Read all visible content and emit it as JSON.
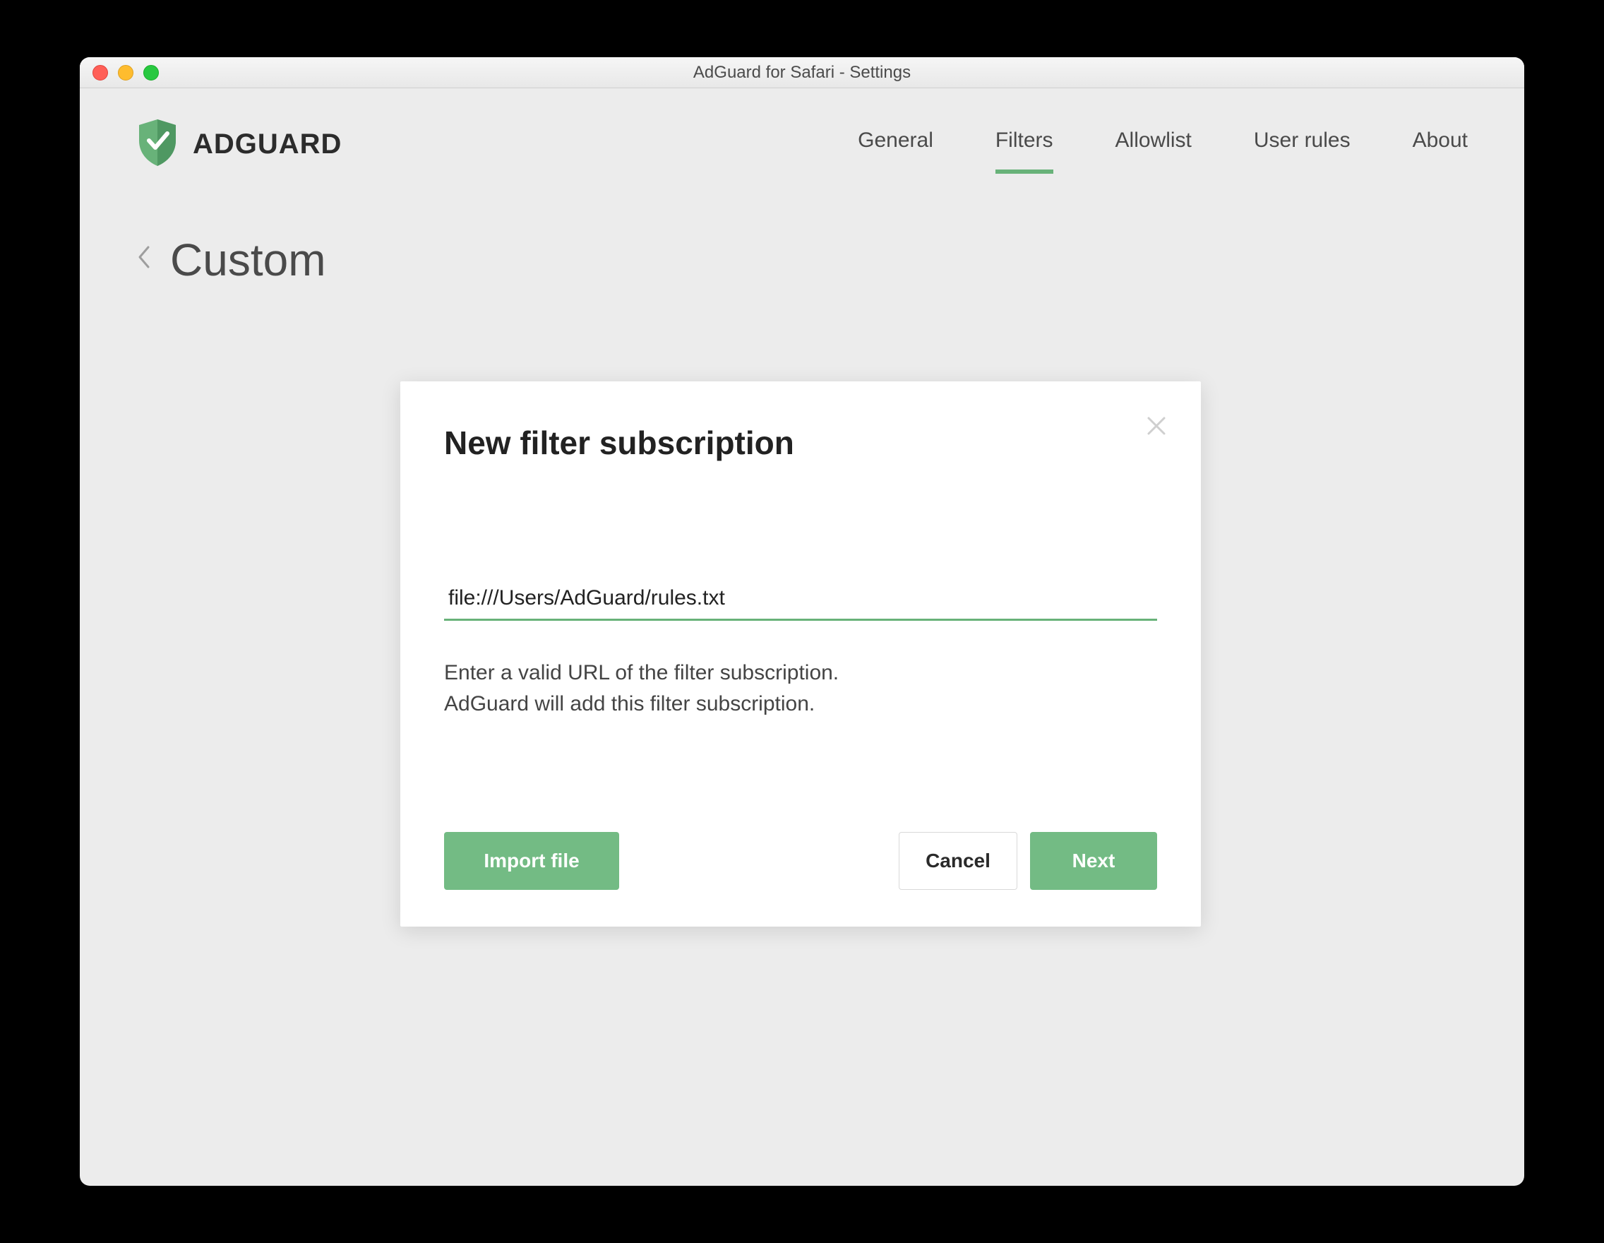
{
  "window": {
    "title": "AdGuard for Safari - Settings"
  },
  "brand": {
    "name": "ADGUARD",
    "accent": "#68b279"
  },
  "nav": {
    "items": [
      {
        "label": "General",
        "active": false
      },
      {
        "label": "Filters",
        "active": true
      },
      {
        "label": "Allowlist",
        "active": false
      },
      {
        "label": "User rules",
        "active": false
      },
      {
        "label": "About",
        "active": false
      }
    ]
  },
  "page": {
    "title": "Custom"
  },
  "dialog": {
    "title": "New filter subscription",
    "url_value": "file:///Users/AdGuard/rules.txt",
    "help_line1": "Enter a valid URL of the filter subscription.",
    "help_line2": "AdGuard will add this filter subscription.",
    "import_label": "Import file",
    "cancel_label": "Cancel",
    "next_label": "Next"
  }
}
